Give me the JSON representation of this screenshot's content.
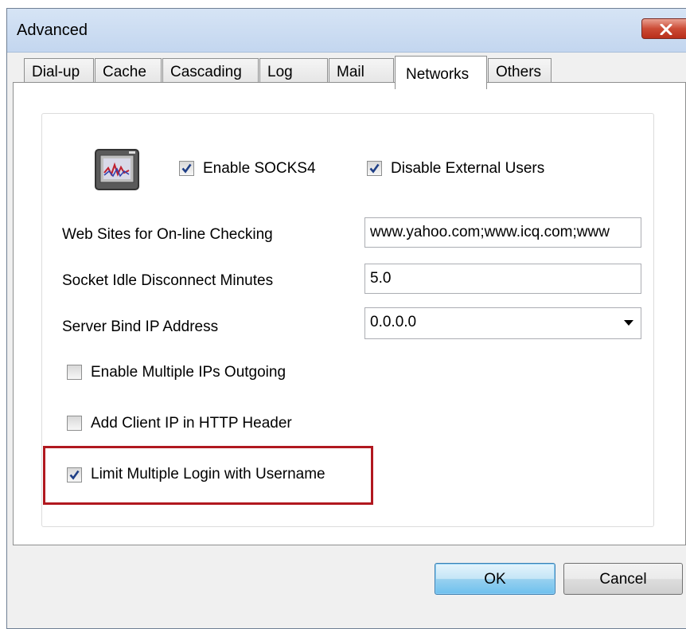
{
  "dialog": {
    "title": "Advanced",
    "close_icon": "close-x-icon"
  },
  "tabs": [
    {
      "label": "Dial-up",
      "active": false
    },
    {
      "label": "Cache",
      "active": false
    },
    {
      "label": "Cascading",
      "active": false
    },
    {
      "label": "Log",
      "active": false
    },
    {
      "label": "Mail",
      "active": false
    },
    {
      "label": "Networks",
      "active": true
    },
    {
      "label": "Others",
      "active": false
    }
  ],
  "networks": {
    "app_icon": "network-monitor-icon",
    "enable_socks4": {
      "label": "Enable SOCKS4",
      "checked": true
    },
    "disable_external_users": {
      "label": "Disable External Users",
      "checked": true
    },
    "web_sites": {
      "label": "Web Sites for On-line Checking",
      "value": "www.yahoo.com;www.icq.com;www"
    },
    "socket_idle": {
      "label": "Socket Idle Disconnect Minutes",
      "value": "5.0"
    },
    "server_bind_ip": {
      "label": "Server Bind IP Address",
      "value": "0.0.0.0"
    },
    "enable_multiple_ips": {
      "label": "Enable Multiple IPs Outgoing",
      "checked": false
    },
    "add_client_ip": {
      "label": "Add Client IP in HTTP Header",
      "checked": false
    },
    "limit_multiple_login": {
      "label": "Limit Multiple Login with Username",
      "checked": true
    }
  },
  "buttons": {
    "ok": "OK",
    "cancel": "Cancel"
  },
  "colors": {
    "highlight_box": "#b1181f",
    "check_mark": "#1f3f86"
  }
}
